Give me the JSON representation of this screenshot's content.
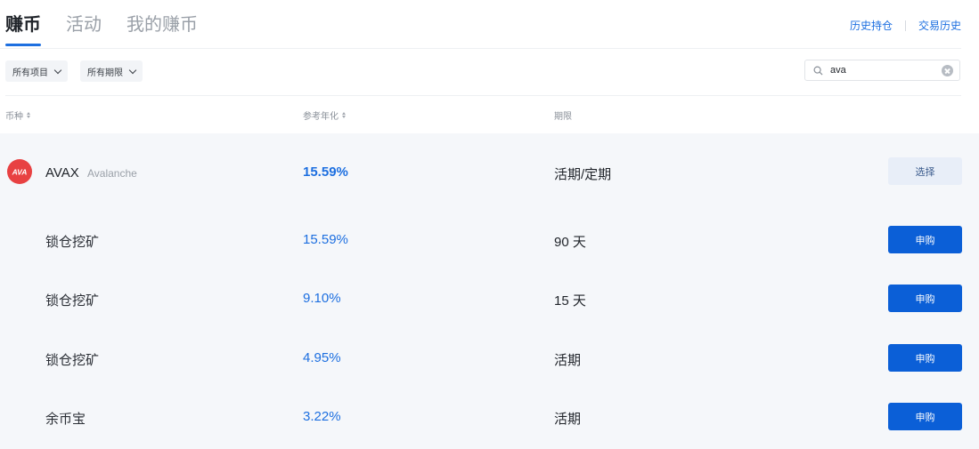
{
  "tabs": [
    {
      "label": "赚币",
      "active": true
    },
    {
      "label": "活动",
      "active": false
    },
    {
      "label": "我的赚币",
      "active": false
    }
  ],
  "top_links": [
    "历史持仓",
    "交易历史"
  ],
  "filters": [
    {
      "label": "所有项目"
    },
    {
      "label": "所有期限"
    }
  ],
  "search": {
    "value": "ava",
    "icon": "search-icon"
  },
  "table": {
    "headers": {
      "coin": "币种",
      "rate": "参考年化",
      "term": "期限"
    },
    "coin": {
      "symbol": "AVAX",
      "name": "Avalanche",
      "rate": "15.59%",
      "term": "活期/定期",
      "action": "选择",
      "logo_color": "#e84142"
    },
    "products": [
      {
        "name": "锁仓挖矿",
        "rate": "15.59%",
        "term": "90 天",
        "action": "申购"
      },
      {
        "name": "锁仓挖矿",
        "rate": "9.10%",
        "term": "15 天",
        "action": "申购"
      },
      {
        "name": "锁仓挖矿",
        "rate": "4.95%",
        "term": "活期",
        "action": "申购"
      },
      {
        "name": "余币宝",
        "rate": "3.22%",
        "term": "活期",
        "action": "申购"
      }
    ]
  },
  "colors": {
    "accent": "#1d6fe0",
    "button": "#0b5fd7",
    "row_bg": "#f5f7fa"
  }
}
